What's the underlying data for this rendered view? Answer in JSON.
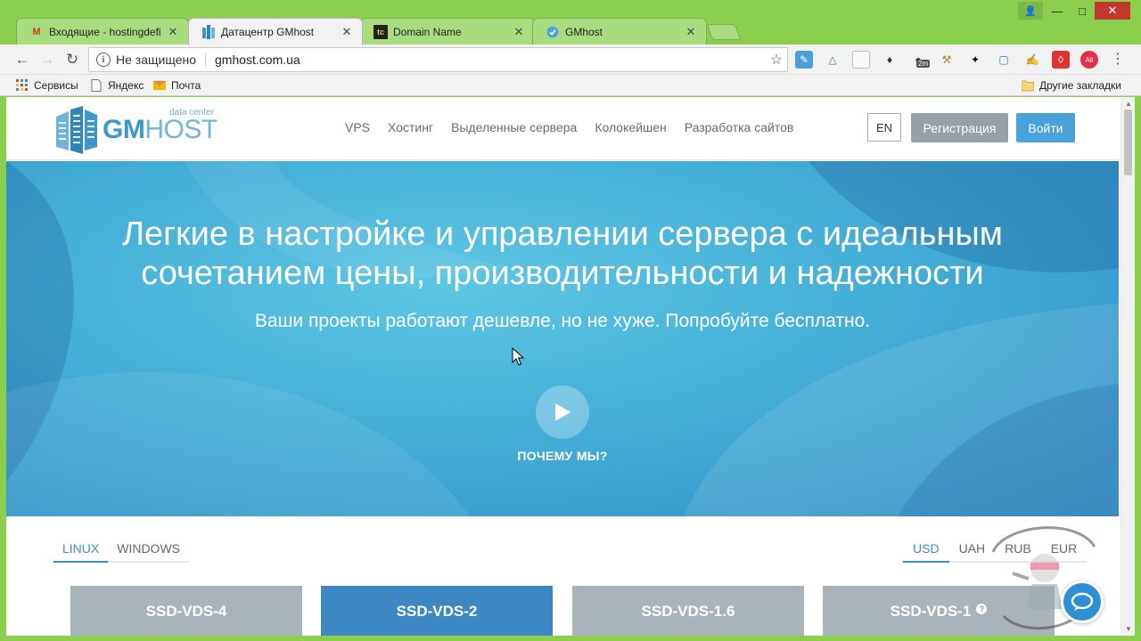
{
  "browser": {
    "tabs": [
      {
        "label": "Входящие - hostingdefi",
        "favicon": "gmail-icon"
      },
      {
        "label": "Датацентр GMhost",
        "favicon": "gmhost-icon"
      },
      {
        "label": "Domain Name",
        "favicon": "tc-icon",
        "favicon_text": "tc"
      },
      {
        "label": "GMhost",
        "favicon": "gmhost-round-icon"
      }
    ],
    "active_tab": 1,
    "omnibox": {
      "security_text": "Не защищено",
      "url": "gmhost.com.ua"
    },
    "extension_badge": "2m",
    "bookmarks": [
      {
        "label": "Сервисы"
      },
      {
        "label": "Яндекс"
      },
      {
        "label": "Почта"
      }
    ],
    "other_bookmarks": "Другие закладки"
  },
  "site": {
    "logo": {
      "gm": "GM",
      "host": "HOST",
      "sub": "data center"
    },
    "nav": [
      "VPS",
      "Хостинг",
      "Выделенные сервера",
      "Колокейшен",
      "Разработка сайтов"
    ],
    "lang": "EN",
    "register": "Регистрация",
    "login": "Войти"
  },
  "hero": {
    "title_line1": "Легкие в настройке и управлении сервера с идеальным",
    "title_line2": "сочетанием цены, производительности и надежности",
    "subtitle": "Ваши проекты работают дешевле, но не хуже. Попробуйте бесплатно.",
    "why": "ПОЧЕМУ МЫ?"
  },
  "os_tabs": [
    "LINUX",
    "WINDOWS"
  ],
  "os_active": "LINUX",
  "currency_tabs": [
    "USD",
    "UAH",
    "RUB",
    "EUR"
  ],
  "currency_active": "USD",
  "plans": [
    {
      "name": "SSD-VDS-4",
      "style": "gray"
    },
    {
      "name": "SSD-VDS-2",
      "style": "blue"
    },
    {
      "name": "SSD-VDS-1.6",
      "style": "gray"
    },
    {
      "name": "SSD-VDS-1",
      "style": "gray",
      "help": "?"
    }
  ],
  "colors": {
    "chrome": "#8ccf4f",
    "accent_blue": "#3d88c3",
    "plan_gray": "#a9b4ba",
    "hero": "#45aed8"
  }
}
